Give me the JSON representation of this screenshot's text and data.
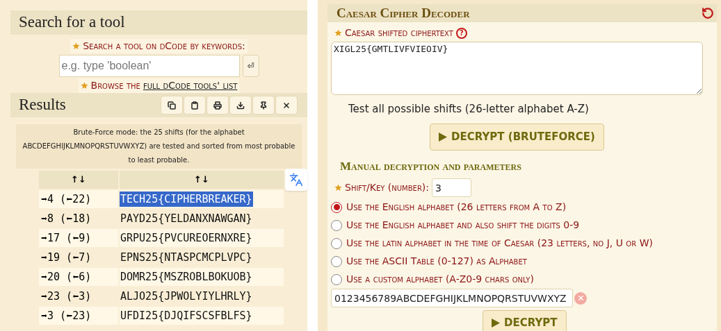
{
  "search_panel": {
    "title": "Search for a tool",
    "search_label": "Search a tool on dCode by keywords:",
    "search_field": {
      "placeholder": "e.g. type 'boolean'"
    },
    "enter_key": "⏎",
    "browse_prefix": "Browse the",
    "browse_link": "full dCode tools' list"
  },
  "results": {
    "title": "Results",
    "note": "Brute-Force mode: the 25 shifts (for the alphabet ABCDEFGHIJKLMNOPQRSTUVWXYZ) are tested and sorted from most probable to least probable.",
    "columns": [
      "↑↓",
      "↑↓"
    ],
    "rows": [
      {
        "shift": "➡4 (⬅22)",
        "text": "TECH25{CIPHERBREAKER}",
        "selected": true
      },
      {
        "shift": "➡8 (⬅18)",
        "text": "PAYD25{YELDANXNAWGAN}",
        "selected": false
      },
      {
        "shift": "➡17 (⬅9)",
        "text": "GRPU25{PVCUREOERNXRE}",
        "selected": false
      },
      {
        "shift": "➡19 (⬅7)",
        "text": "EPNS25{NTASPCMCPLVPC}",
        "selected": false
      },
      {
        "shift": "➡20 (⬅6)",
        "text": "DOMR25{MSZROBLBOKUOB}",
        "selected": false
      },
      {
        "shift": "➡23 (⬅3)",
        "text": "ALJO25{JPWOLYIYLHRLY}",
        "selected": false
      },
      {
        "shift": "➡3 (⬅23)",
        "text": "UFDI25{DJQIFSCSFBLFS}",
        "selected": false
      }
    ]
  },
  "decoder": {
    "title": "Caesar Cipher Decoder",
    "ciphertext_label": "Caesar shifted ciphertext",
    "help": "?",
    "ciphertext": "XIGL25{GMTLIVFVIEOIV}",
    "bruteforce_hint": "Test all possible shifts (26-letter alphabet A-Z)",
    "bruteforce_button": "DECRYPT (BRUTEFORCE)",
    "manual_title": "Manual decryption and parameters",
    "shift_label": "Shift/Key (number):",
    "shift_value": "3",
    "alphabets": [
      {
        "label": "Use the English alphabet (26 letters from A to Z)",
        "selected": true
      },
      {
        "label": "Use the English alphabet and also shift the digits 0-9",
        "selected": false
      },
      {
        "label": "Use the latin alphabet in the time of Caesar (23 letters, no J, U or W)",
        "selected": false
      },
      {
        "label": "Use the ASCII Table (0-127) as Alphabet",
        "selected": false
      },
      {
        "label": "Use a custom alphabet (A-Z0-9 chars only)",
        "selected": false
      }
    ],
    "custom_alphabet": "0123456789ABCDEFGHIJKLMNOPQRSTUVWXYZ",
    "decrypt_button": "DECRYPT"
  }
}
